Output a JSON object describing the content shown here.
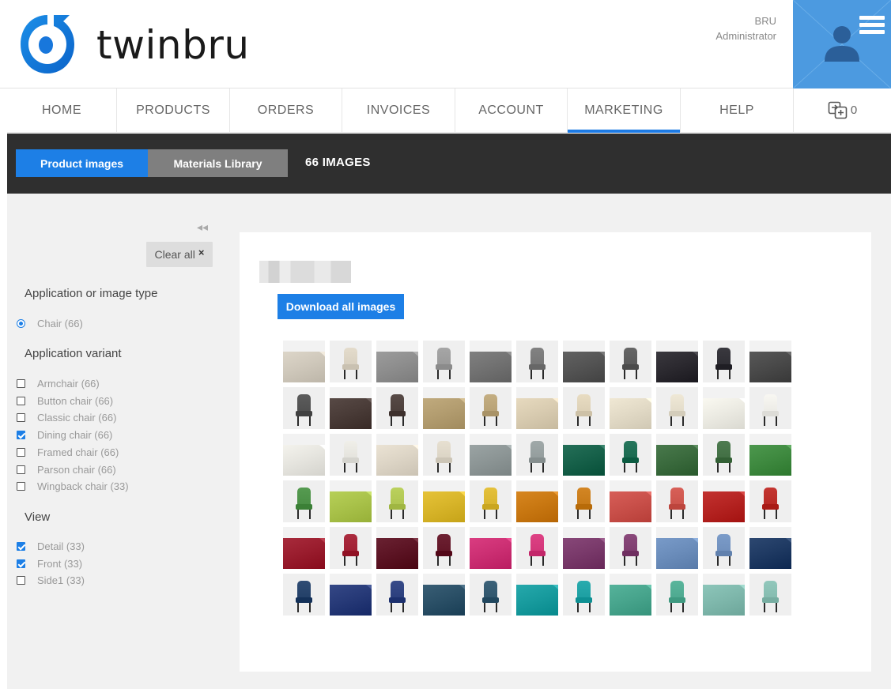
{
  "brand": {
    "name": "twinbru"
  },
  "user": {
    "name": "BRU",
    "role": "Administrator"
  },
  "nav": {
    "items": [
      {
        "label": "HOME",
        "active": false
      },
      {
        "label": "PRODUCTS",
        "active": false
      },
      {
        "label": "ORDERS",
        "active": false
      },
      {
        "label": "INVOICES",
        "active": false
      },
      {
        "label": "ACCOUNT",
        "active": false
      },
      {
        "label": "MARKETING",
        "active": true
      },
      {
        "label": "HELP",
        "active": false
      }
    ],
    "cart_count": "0"
  },
  "toolbar": {
    "product_images": "Product images",
    "materials_library": "Materials Library",
    "count": "66 IMAGES"
  },
  "filters": {
    "collapse_symbol": "◂◂",
    "clear_all": "Clear all",
    "clear_x": "×",
    "groups": [
      {
        "title": "Application or image type",
        "type": "radio",
        "options": [
          {
            "label": "Chair (66)",
            "checked": true
          }
        ]
      },
      {
        "title": "Application variant",
        "type": "checkbox",
        "options": [
          {
            "label": "Armchair (66)",
            "checked": false
          },
          {
            "label": "Button chair (66)",
            "checked": false
          },
          {
            "label": "Classic chair (66)",
            "checked": false
          },
          {
            "label": "Dining chair (66)",
            "checked": true
          },
          {
            "label": "Framed chair (66)",
            "checked": false
          },
          {
            "label": "Parson chair (66)",
            "checked": false
          },
          {
            "label": "Wingback chair (33)",
            "checked": false
          }
        ]
      },
      {
        "title": "View",
        "type": "checkbox",
        "options": [
          {
            "label": "Detail (33)",
            "checked": true
          },
          {
            "label": "Front (33)",
            "checked": true
          },
          {
            "label": "Side1 (33)",
            "checked": false
          }
        ]
      }
    ]
  },
  "gallery": {
    "download_label": "Download all images",
    "tiles": [
      {
        "view": "detail",
        "color": "#cfc8bb"
      },
      {
        "view": "front",
        "color": "#d8d0c0"
      },
      {
        "view": "detail",
        "color": "#8e8e8e"
      },
      {
        "view": "front",
        "color": "#9a9a9a"
      },
      {
        "view": "detail",
        "color": "#727272"
      },
      {
        "view": "front",
        "color": "#767676"
      },
      {
        "view": "detail",
        "color": "#545454"
      },
      {
        "view": "front",
        "color": "#5a5a5a"
      },
      {
        "view": "detail",
        "color": "#2c2a30"
      },
      {
        "view": "front",
        "color": "#2e2d33"
      },
      {
        "view": "detail",
        "color": "#4a4a4a"
      },
      {
        "view": "front",
        "color": "#505050"
      },
      {
        "view": "detail",
        "color": "#4a3c38"
      },
      {
        "view": "front",
        "color": "#4c3f3b"
      },
      {
        "view": "detail",
        "color": "#b39d70"
      },
      {
        "view": "front",
        "color": "#b8a276"
      },
      {
        "view": "detail",
        "color": "#d9ccb1"
      },
      {
        "view": "front",
        "color": "#dcd0b6"
      },
      {
        "view": "detail",
        "color": "#e2dac6"
      },
      {
        "view": "front",
        "color": "#e3dcca"
      },
      {
        "view": "detail",
        "color": "#ecebe3"
      },
      {
        "view": "front",
        "color": "#ecebe6"
      },
      {
        "view": "detail",
        "color": "#e6e5df"
      },
      {
        "view": "front",
        "color": "#e4e3dd"
      },
      {
        "view": "detail",
        "color": "#ddd5c6"
      },
      {
        "view": "front",
        "color": "#dbd4c5"
      },
      {
        "view": "detail",
        "color": "#8d9696"
      },
      {
        "view": "front",
        "color": "#949d9d"
      },
      {
        "view": "detail",
        "color": "#17614a"
      },
      {
        "view": "front",
        "color": "#1a6a50"
      },
      {
        "view": "detail",
        "color": "#3b6b3e"
      },
      {
        "view": "front",
        "color": "#426f44"
      },
      {
        "view": "detail",
        "color": "#3f8a40"
      },
      {
        "view": "front",
        "color": "#4a8f45"
      },
      {
        "view": "detail",
        "color": "#a9c24a"
      },
      {
        "view": "front",
        "color": "#afc551"
      },
      {
        "view": "detail",
        "color": "#d8b52a"
      },
      {
        "view": "front",
        "color": "#d9b52f"
      },
      {
        "view": "detail",
        "color": "#c97812"
      },
      {
        "view": "front",
        "color": "#c77a18"
      },
      {
        "view": "detail",
        "color": "#c9504a"
      },
      {
        "view": "front",
        "color": "#cc544c"
      },
      {
        "view": "detail",
        "color": "#b52422"
      },
      {
        "view": "front",
        "color": "#b82a25"
      },
      {
        "view": "detail",
        "color": "#9a1d2e"
      },
      {
        "view": "front",
        "color": "#a02033"
      },
      {
        "view": "detail",
        "color": "#5c1424"
      },
      {
        "view": "front",
        "color": "#621627"
      },
      {
        "view": "detail",
        "color": "#cc2f73"
      },
      {
        "view": "front",
        "color": "#d23679"
      },
      {
        "view": "detail",
        "color": "#7a3a6b"
      },
      {
        "view": "front",
        "color": "#7e3d6f"
      },
      {
        "view": "detail",
        "color": "#6b8dbb"
      },
      {
        "view": "front",
        "color": "#7090bd"
      },
      {
        "view": "detail",
        "color": "#1f3a63"
      },
      {
        "view": "front",
        "color": "#234068"
      },
      {
        "view": "detail",
        "color": "#273a78"
      },
      {
        "view": "front",
        "color": "#2b3f7d"
      },
      {
        "view": "detail",
        "color": "#2b5067"
      },
      {
        "view": "front",
        "color": "#30566d"
      },
      {
        "view": "detail",
        "color": "#189b9e"
      },
      {
        "view": "front",
        "color": "#1d9fa2"
      },
      {
        "view": "detail",
        "color": "#48a58d"
      },
      {
        "view": "front",
        "color": "#4ea990"
      },
      {
        "view": "detail",
        "color": "#7fb8ac"
      },
      {
        "view": "front",
        "color": "#86bcb0"
      }
    ]
  }
}
